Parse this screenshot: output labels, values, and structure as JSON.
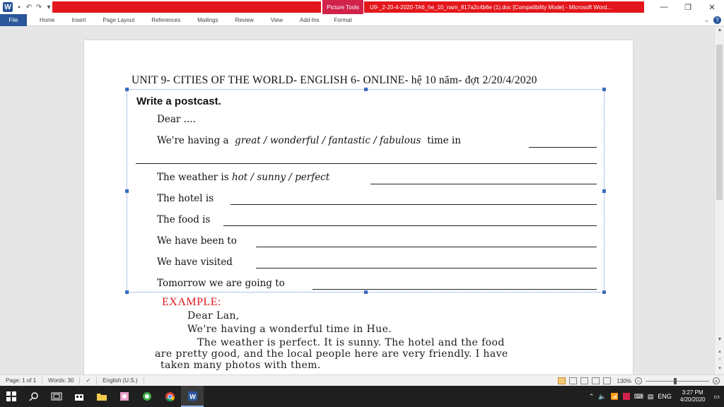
{
  "window": {
    "picture_tools": "Picture Tools",
    "title": "U9-_2-20-4-2020-TA6_he_10_nam_817a2c4b6e (1).doc [Compatibility Mode] - Microsoft Word...",
    "minimize": "—",
    "restore": "❐",
    "close": "✕"
  },
  "ribbon": {
    "tabs": [
      "File",
      "Home",
      "Insert",
      "Page Layout",
      "References",
      "Mailings",
      "Review",
      "View",
      "Add-Ins"
    ],
    "format": "Format"
  },
  "document": {
    "heading": "UNIT 9- CITIES OF THE WORLD- ENGLISH 6- ONLINE- hệ 10 năm- đợt 2/20/4/2020",
    "write_title": "Write a postcast.",
    "dear": "Dear ....",
    "having_prefix": "We're having a",
    "having_options": "great / wonderful / fantastic / fabulous",
    "having_suffix": "time in",
    "weather_prefix": "The weather is",
    "weather_options": "hot / sunny / perfect",
    "hotel": "The hotel is",
    "food": "The food is",
    "been": "We have been to",
    "visited": "We have visited",
    "tomorrow": "Tomorrow we are going to",
    "example_label": "EXAMPLE:",
    "example_lines": [
      "Dear Lan,",
      "We're having a  wonderful time in Hue.",
      "The weather is  perfect. It is sunny. The hotel and the food",
      "are pretty good, and the local people here are very friendly. I have",
      "taken many photos with them."
    ]
  },
  "status": {
    "page": "Page: 1 of 1",
    "words": "Words: 30",
    "language": "English (U.S.)",
    "zoom": "130%"
  },
  "taskbar": {
    "time": "3:27 PM",
    "date": "4/20/2020",
    "lang": "ENG"
  }
}
